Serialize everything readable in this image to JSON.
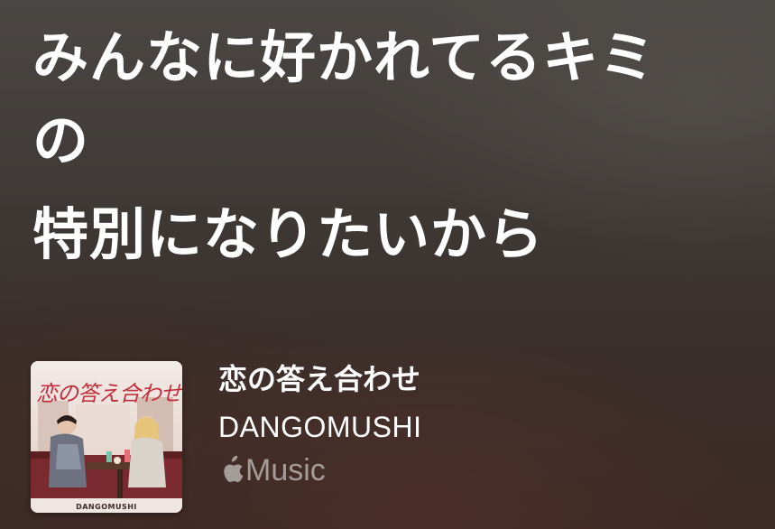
{
  "lyrics": {
    "line1": "みんなに好かれてるキミ",
    "line1_wrap": "の",
    "line2": "特別になりたいから"
  },
  "track": {
    "title": "恋の答え合わせ",
    "artist": "DANGOMUSHI",
    "service": "Music",
    "service_icon": "apple-logo-icon",
    "artwork": {
      "title_text": "恋の答え合わせ",
      "caption": "DANGOMUSHI"
    }
  },
  "colors": {
    "lyric_text": "#ffffff",
    "secondary_text": "#a39c98",
    "artwork_title": "#c2303e"
  }
}
